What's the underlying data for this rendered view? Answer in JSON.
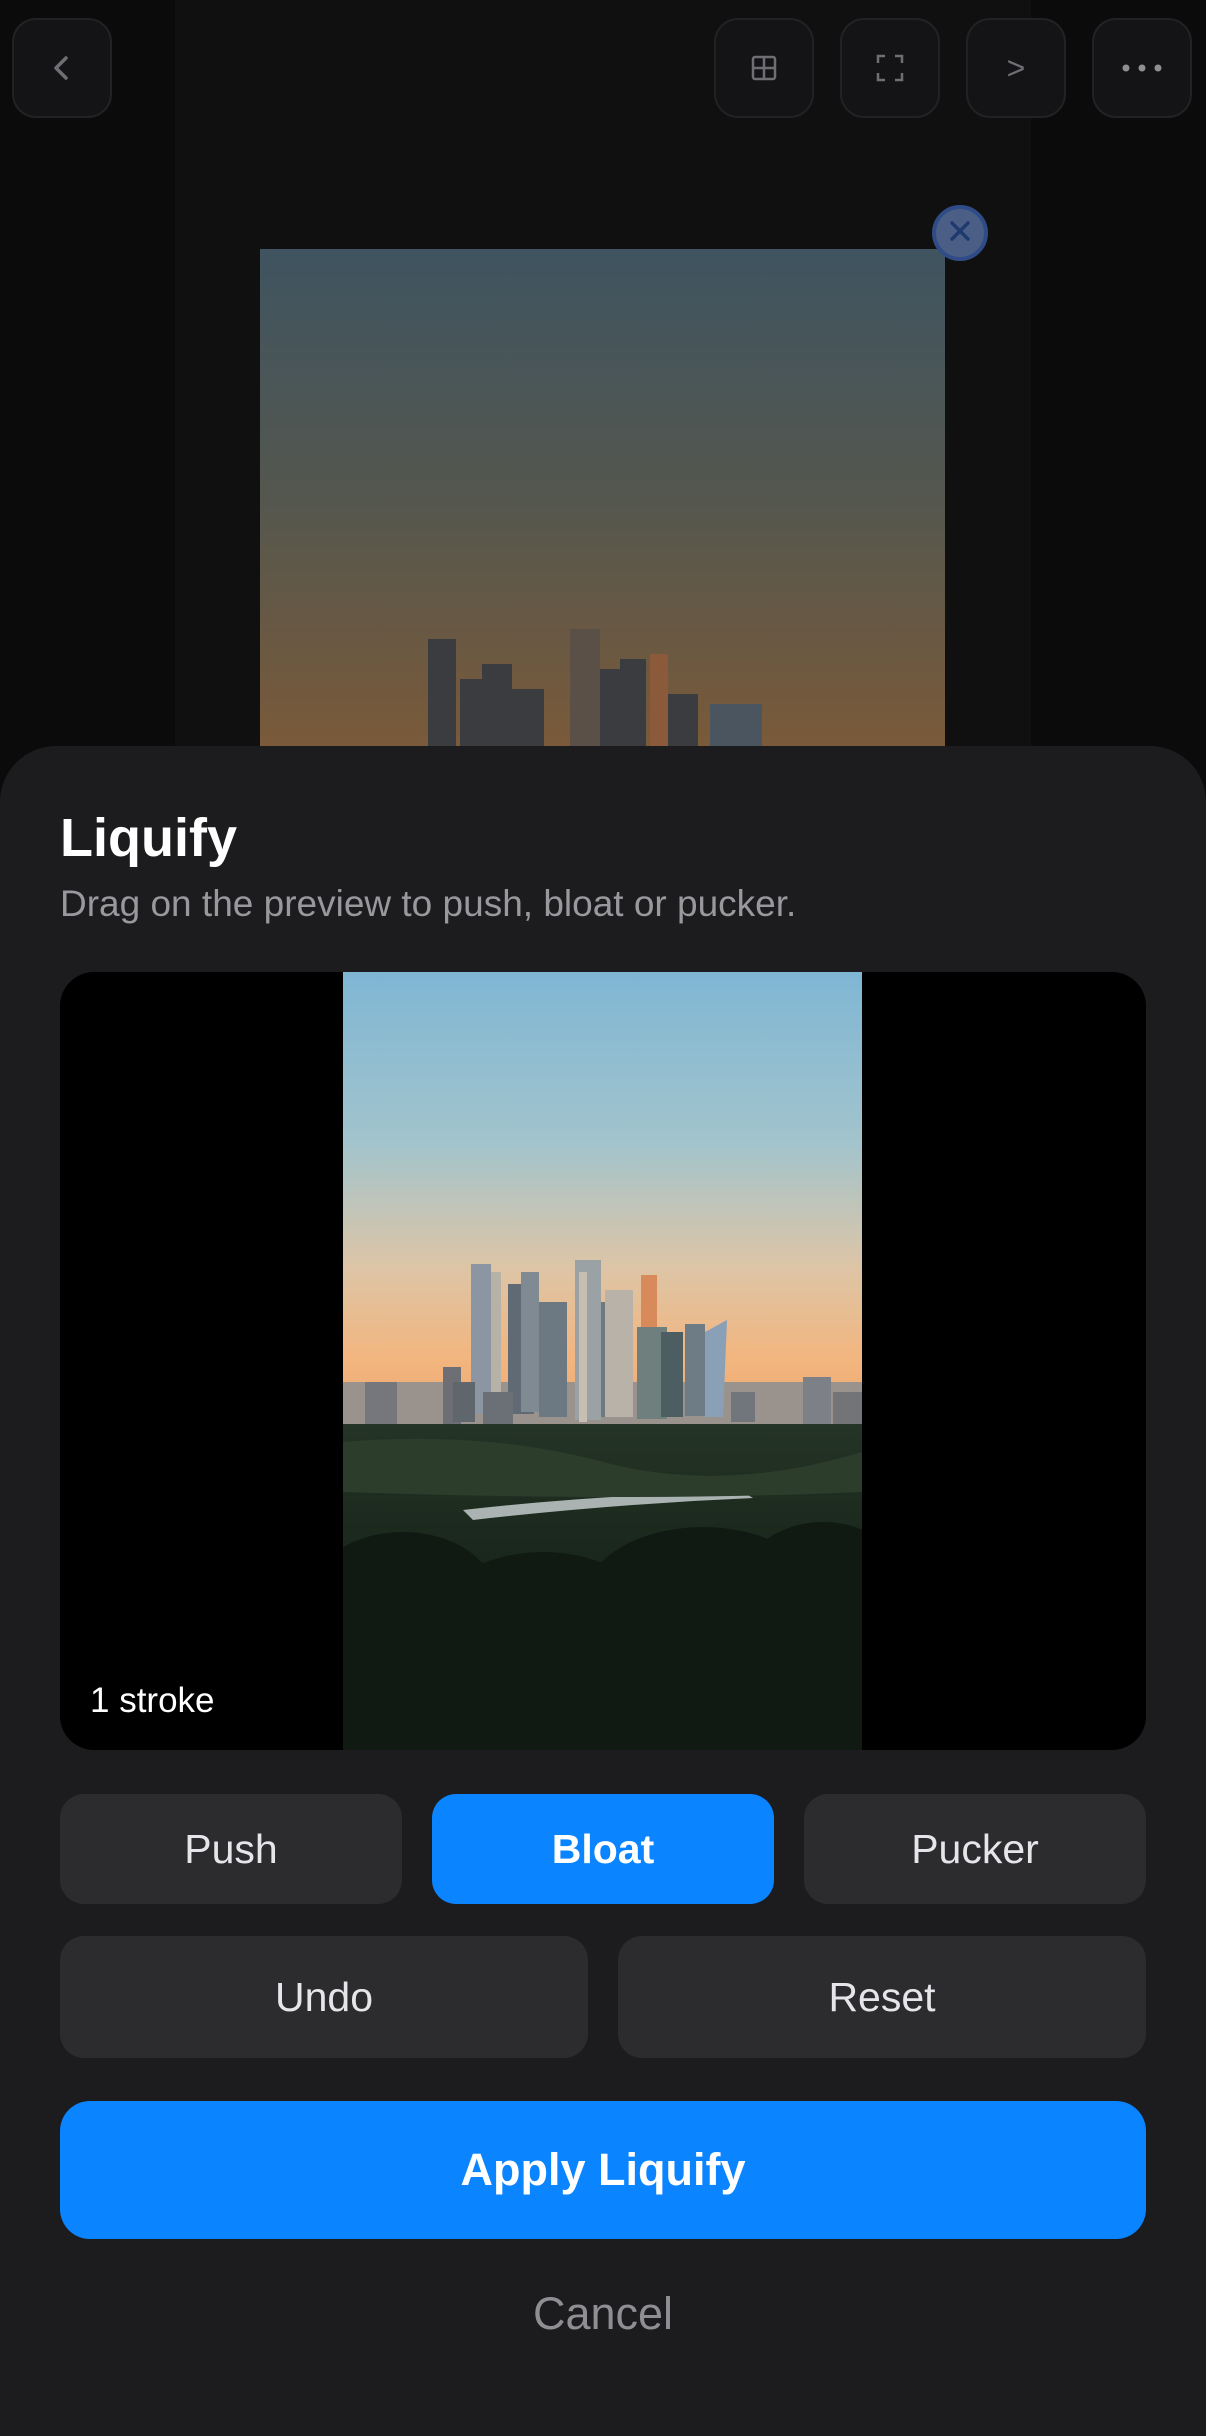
{
  "toolbar": {
    "icons": [
      "chevron-left-icon",
      "grid-icon",
      "fit-frame-icon",
      "chevron-right-icon",
      "more-icon"
    ],
    "next_glyph": ">"
  },
  "sheet": {
    "title": "Liquify",
    "subtitle": "Drag on the preview to push, bloat or pucker.",
    "stroke_count": "1 stroke",
    "modes": [
      {
        "label": "Push",
        "active": false
      },
      {
        "label": "Bloat",
        "active": true
      },
      {
        "label": "Pucker",
        "active": false
      }
    ],
    "undo_label": "Undo",
    "reset_label": "Reset",
    "apply_label": "Apply Liquify",
    "cancel_label": "Cancel"
  },
  "colors": {
    "accent": "#0a84ff",
    "sheet_background": "#1c1c1e",
    "button_background": "#2c2c2e",
    "remove_badge": "#4b5e86"
  }
}
